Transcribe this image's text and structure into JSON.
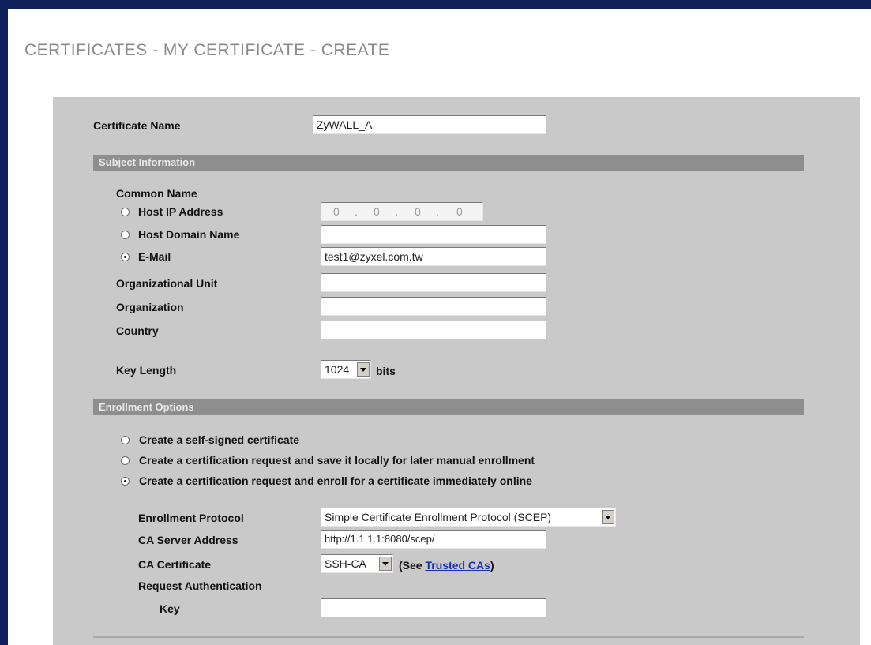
{
  "page_title": "CERTIFICATES - MY CERTIFICATE - CREATE",
  "certificate_name": {
    "label": "Certificate Name",
    "value": "ZyWALL_A"
  },
  "subject": {
    "section_title": "Subject Information",
    "common_name_label": "Common Name",
    "host_ip": {
      "label": "Host IP Address",
      "octets": [
        "0",
        "0",
        "0",
        "0"
      ],
      "dot": ".",
      "selected": false
    },
    "host_domain": {
      "label": "Host Domain Name",
      "value": "",
      "selected": false
    },
    "email": {
      "label": "E-Mail",
      "value": "test1@zyxel.com.tw",
      "selected": true
    },
    "org_unit": {
      "label": "Organizational Unit",
      "value": ""
    },
    "organization": {
      "label": "Organization",
      "value": ""
    },
    "country": {
      "label": "Country",
      "value": ""
    },
    "key_length": {
      "label": "Key Length",
      "value": "1024",
      "unit": "bits"
    }
  },
  "enrollment": {
    "section_title": "Enrollment Options",
    "options": [
      {
        "label": "Create a self-signed certificate",
        "selected": false
      },
      {
        "label": "Create a certification request and save it locally for later manual enrollment",
        "selected": false
      },
      {
        "label": "Create a certification request and enroll for a certificate immediately online",
        "selected": true
      }
    ],
    "protocol": {
      "label": "Enrollment Protocol",
      "value": "Simple Certificate Enrollment Protocol (SCEP)"
    },
    "ca_server": {
      "label": "CA Server Address",
      "value": "http://1.1.1.1:8080/scep/"
    },
    "ca_certificate": {
      "label": "CA Certificate",
      "value": "SSH-CA",
      "see_prefix": "(See",
      "see_link": "Trusted CAs",
      "see_suffix": ")"
    },
    "request_auth_label": "Request Authentication",
    "key": {
      "label": "Key",
      "value": ""
    }
  },
  "colors": {
    "frame": "#0f1f5a",
    "panel": "#c9c9c9",
    "section_bar": "#8e8e8e",
    "title_gray": "#8a8a8a",
    "link": "#1a2fb8"
  }
}
